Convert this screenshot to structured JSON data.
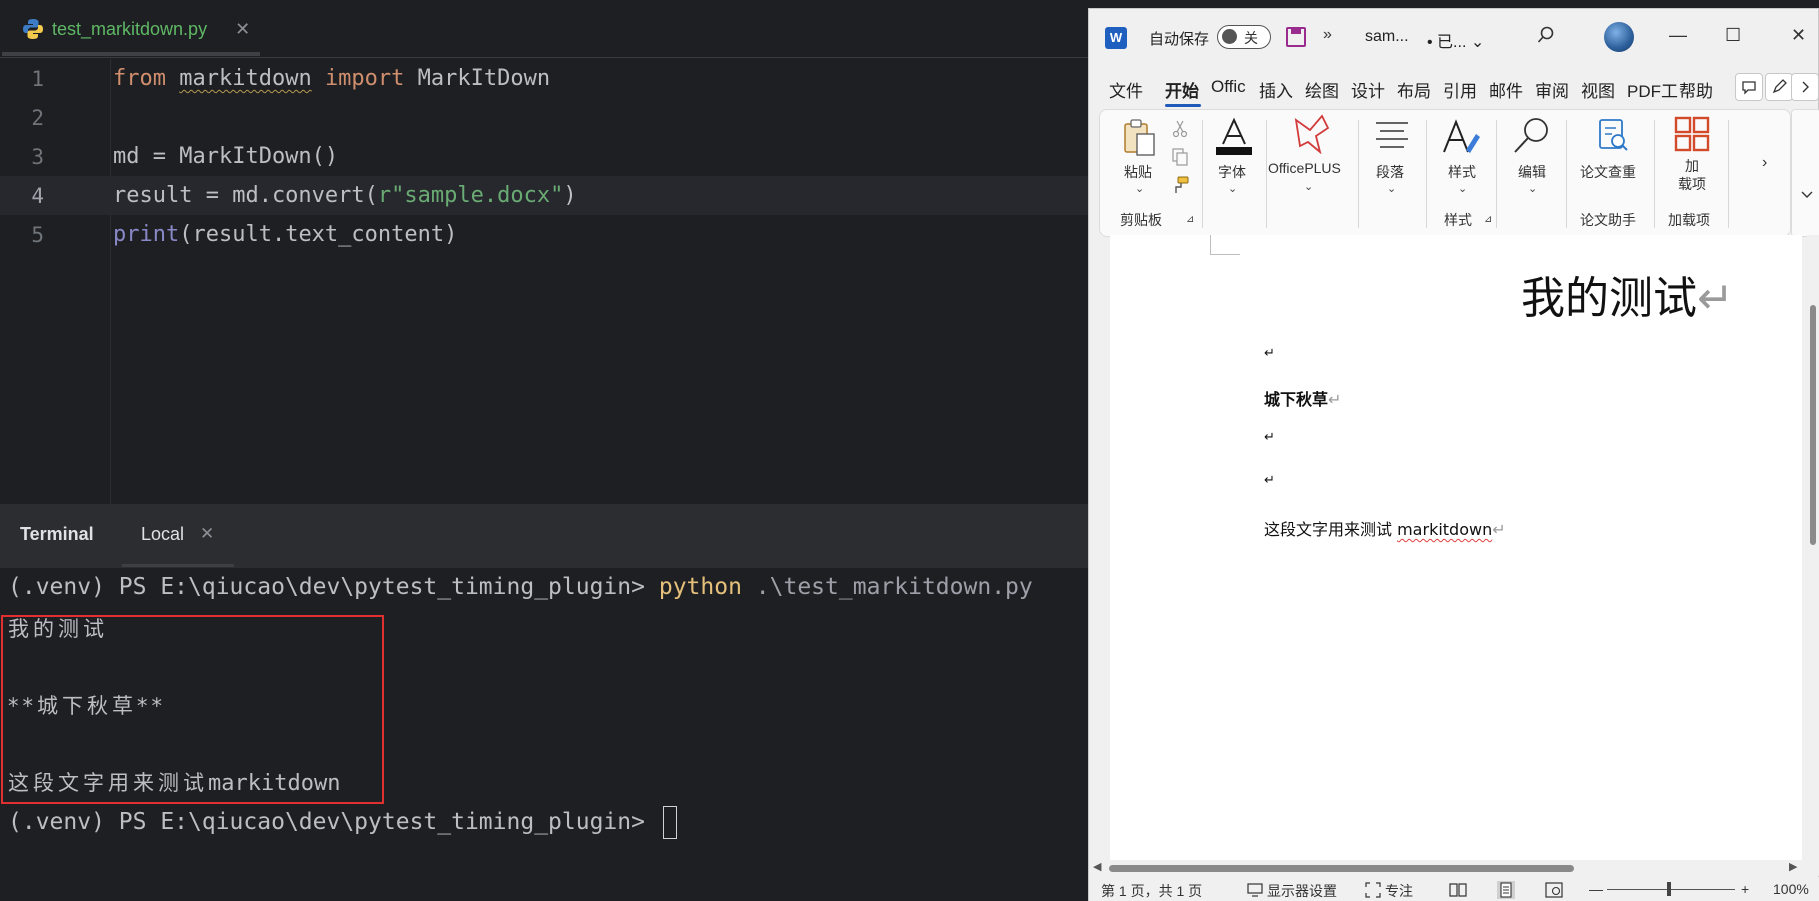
{
  "ide": {
    "file_tab": {
      "name": "test_markitdown.py",
      "close": "✕"
    },
    "lines": [
      {
        "num": "1"
      },
      {
        "num": "2"
      },
      {
        "num": "3"
      },
      {
        "num": "4"
      },
      {
        "num": "5"
      }
    ],
    "code": {
      "l1_from": "from",
      "l1_module": "markitdown",
      "l1_import": "import",
      "l1_class": "MarkItDown",
      "l3": "md = MarkItDown()",
      "l4_pre": "result = md.convert(",
      "l4_str": "r\"sample.docx\"",
      "l4_post": ")",
      "l5_print": "print",
      "l5_rest": "(result.text_content)"
    },
    "terminal": {
      "title": "Terminal",
      "tab": "Local",
      "tab_close": "✕",
      "prompt": "(.venv) PS E:\\qiucao\\dev\\pytest_timing_plugin>",
      "cmd_python": "python",
      "cmd_arg": ".\\test_markitdown.py",
      "out1": "我的测试",
      "out2": "**城下秋草**",
      "out3_cn": "这段文字用来测试",
      "out3_en": "markitdown",
      "prompt2": "(.venv) PS E:\\qiucao\\dev\\pytest_timing_plugin>"
    }
  },
  "word": {
    "app_letter": "W",
    "autosave_label": "自动保存",
    "autosave_state": "关",
    "more": "»",
    "doc_name": "sam...",
    "doc_status": "• 已... ⌄",
    "window": {
      "min": "—",
      "max": "☐",
      "close": "✕"
    },
    "menu": [
      "文件",
      "开始",
      "Offic",
      "插入",
      "绘图",
      "设计",
      "布局",
      "引用",
      "邮件",
      "审阅",
      "视图",
      "PDF工",
      "帮助"
    ],
    "ribbon": {
      "paste": "粘贴",
      "clipboard_group": "剪贴板",
      "font": "字体",
      "officeplus": "OfficePLUS",
      "paragraph": "段落",
      "styles": "样式",
      "styles_group": "样式",
      "edit": "编辑",
      "paper_check": "论文查重",
      "paper_group": "论文助手",
      "addins_line1": "加",
      "addins_line2": "载项",
      "addins_group": "加载项",
      "scroll_right": "›"
    },
    "document": {
      "title": "我的测试",
      "heading": "城下秋草",
      "body_cn": "这段文字用来测试 ",
      "body_en": "markitdown",
      "para_mark": "↵"
    },
    "status": {
      "page": "第 1 页，共 1 页",
      "display": "显示器设置",
      "focus": "专注",
      "zoom_minus": "—",
      "zoom_plus": "+",
      "zoom": "100%"
    }
  }
}
